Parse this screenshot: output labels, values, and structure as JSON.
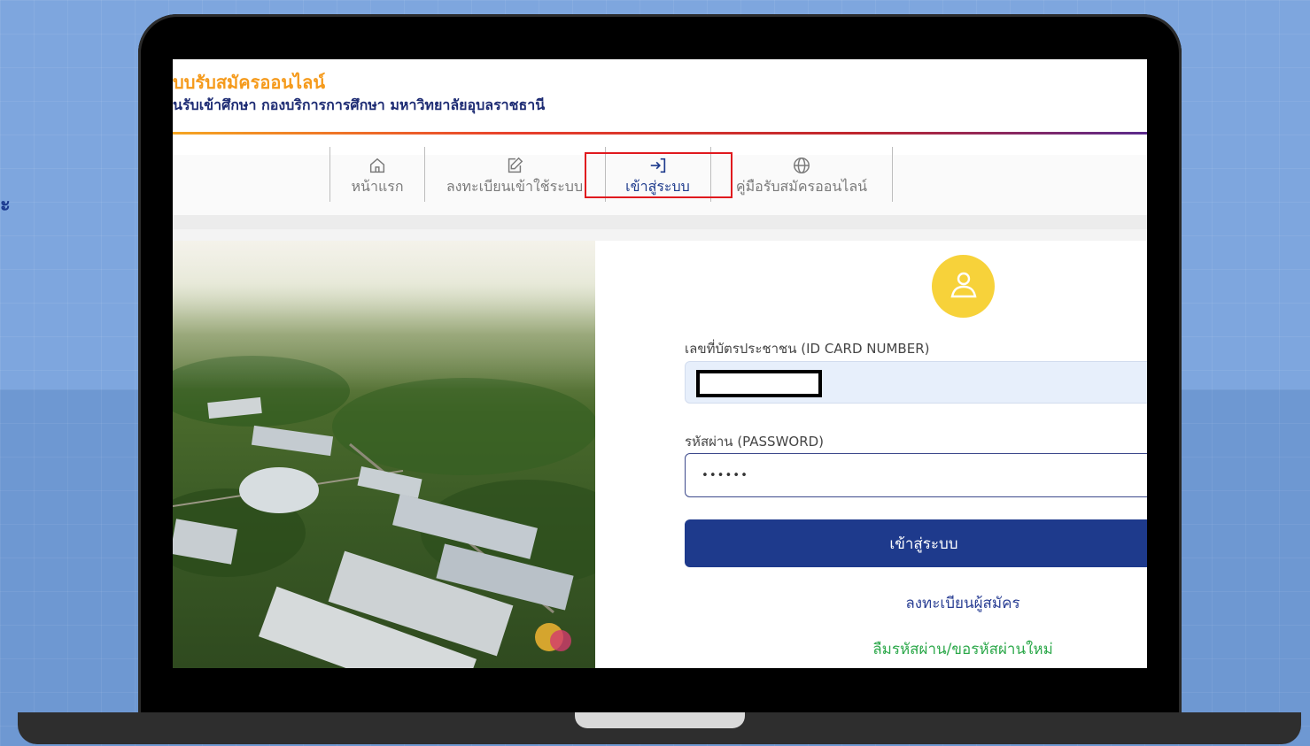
{
  "side_mark": "ะ",
  "header": {
    "title": "บบรับสมัครออนไลน์",
    "subtitle": "นรับเข้าศึกษา กองบริการการศึกษา มหาวิทยาลัยอุบลราชธานี"
  },
  "nav": {
    "items": [
      {
        "label": "หน้าแรก",
        "icon": "home-icon"
      },
      {
        "label": "ลงทะเบียนเข้าใช้ระบบ",
        "icon": "edit-icon"
      },
      {
        "label": "เข้าสู่ระบบ",
        "icon": "login-icon",
        "active": true
      },
      {
        "label": "คู่มือรับสมัครออนไลน์",
        "icon": "globe-icon"
      }
    ]
  },
  "login": {
    "avatar_icon": "user-icon",
    "id_label": "เลขที่บัตรประชาชน (ID CARD NUMBER)",
    "password_label": "รหัสผ่าน (PASSWORD)",
    "password_value": "••••••",
    "submit_label": "เข้าสู่ระบบ",
    "register_link": "ลงทะเบียนผู้สมัคร",
    "forgot_link": "ลืมรหัสผ่าน/ขอรหัสผ่านใหม่"
  },
  "colors": {
    "accent": "#1e3a8c",
    "title_orange": "#f59a1b",
    "highlight_red": "#e0191e",
    "link_green": "#2ca84a",
    "avatar_yellow": "#f7d23a"
  }
}
